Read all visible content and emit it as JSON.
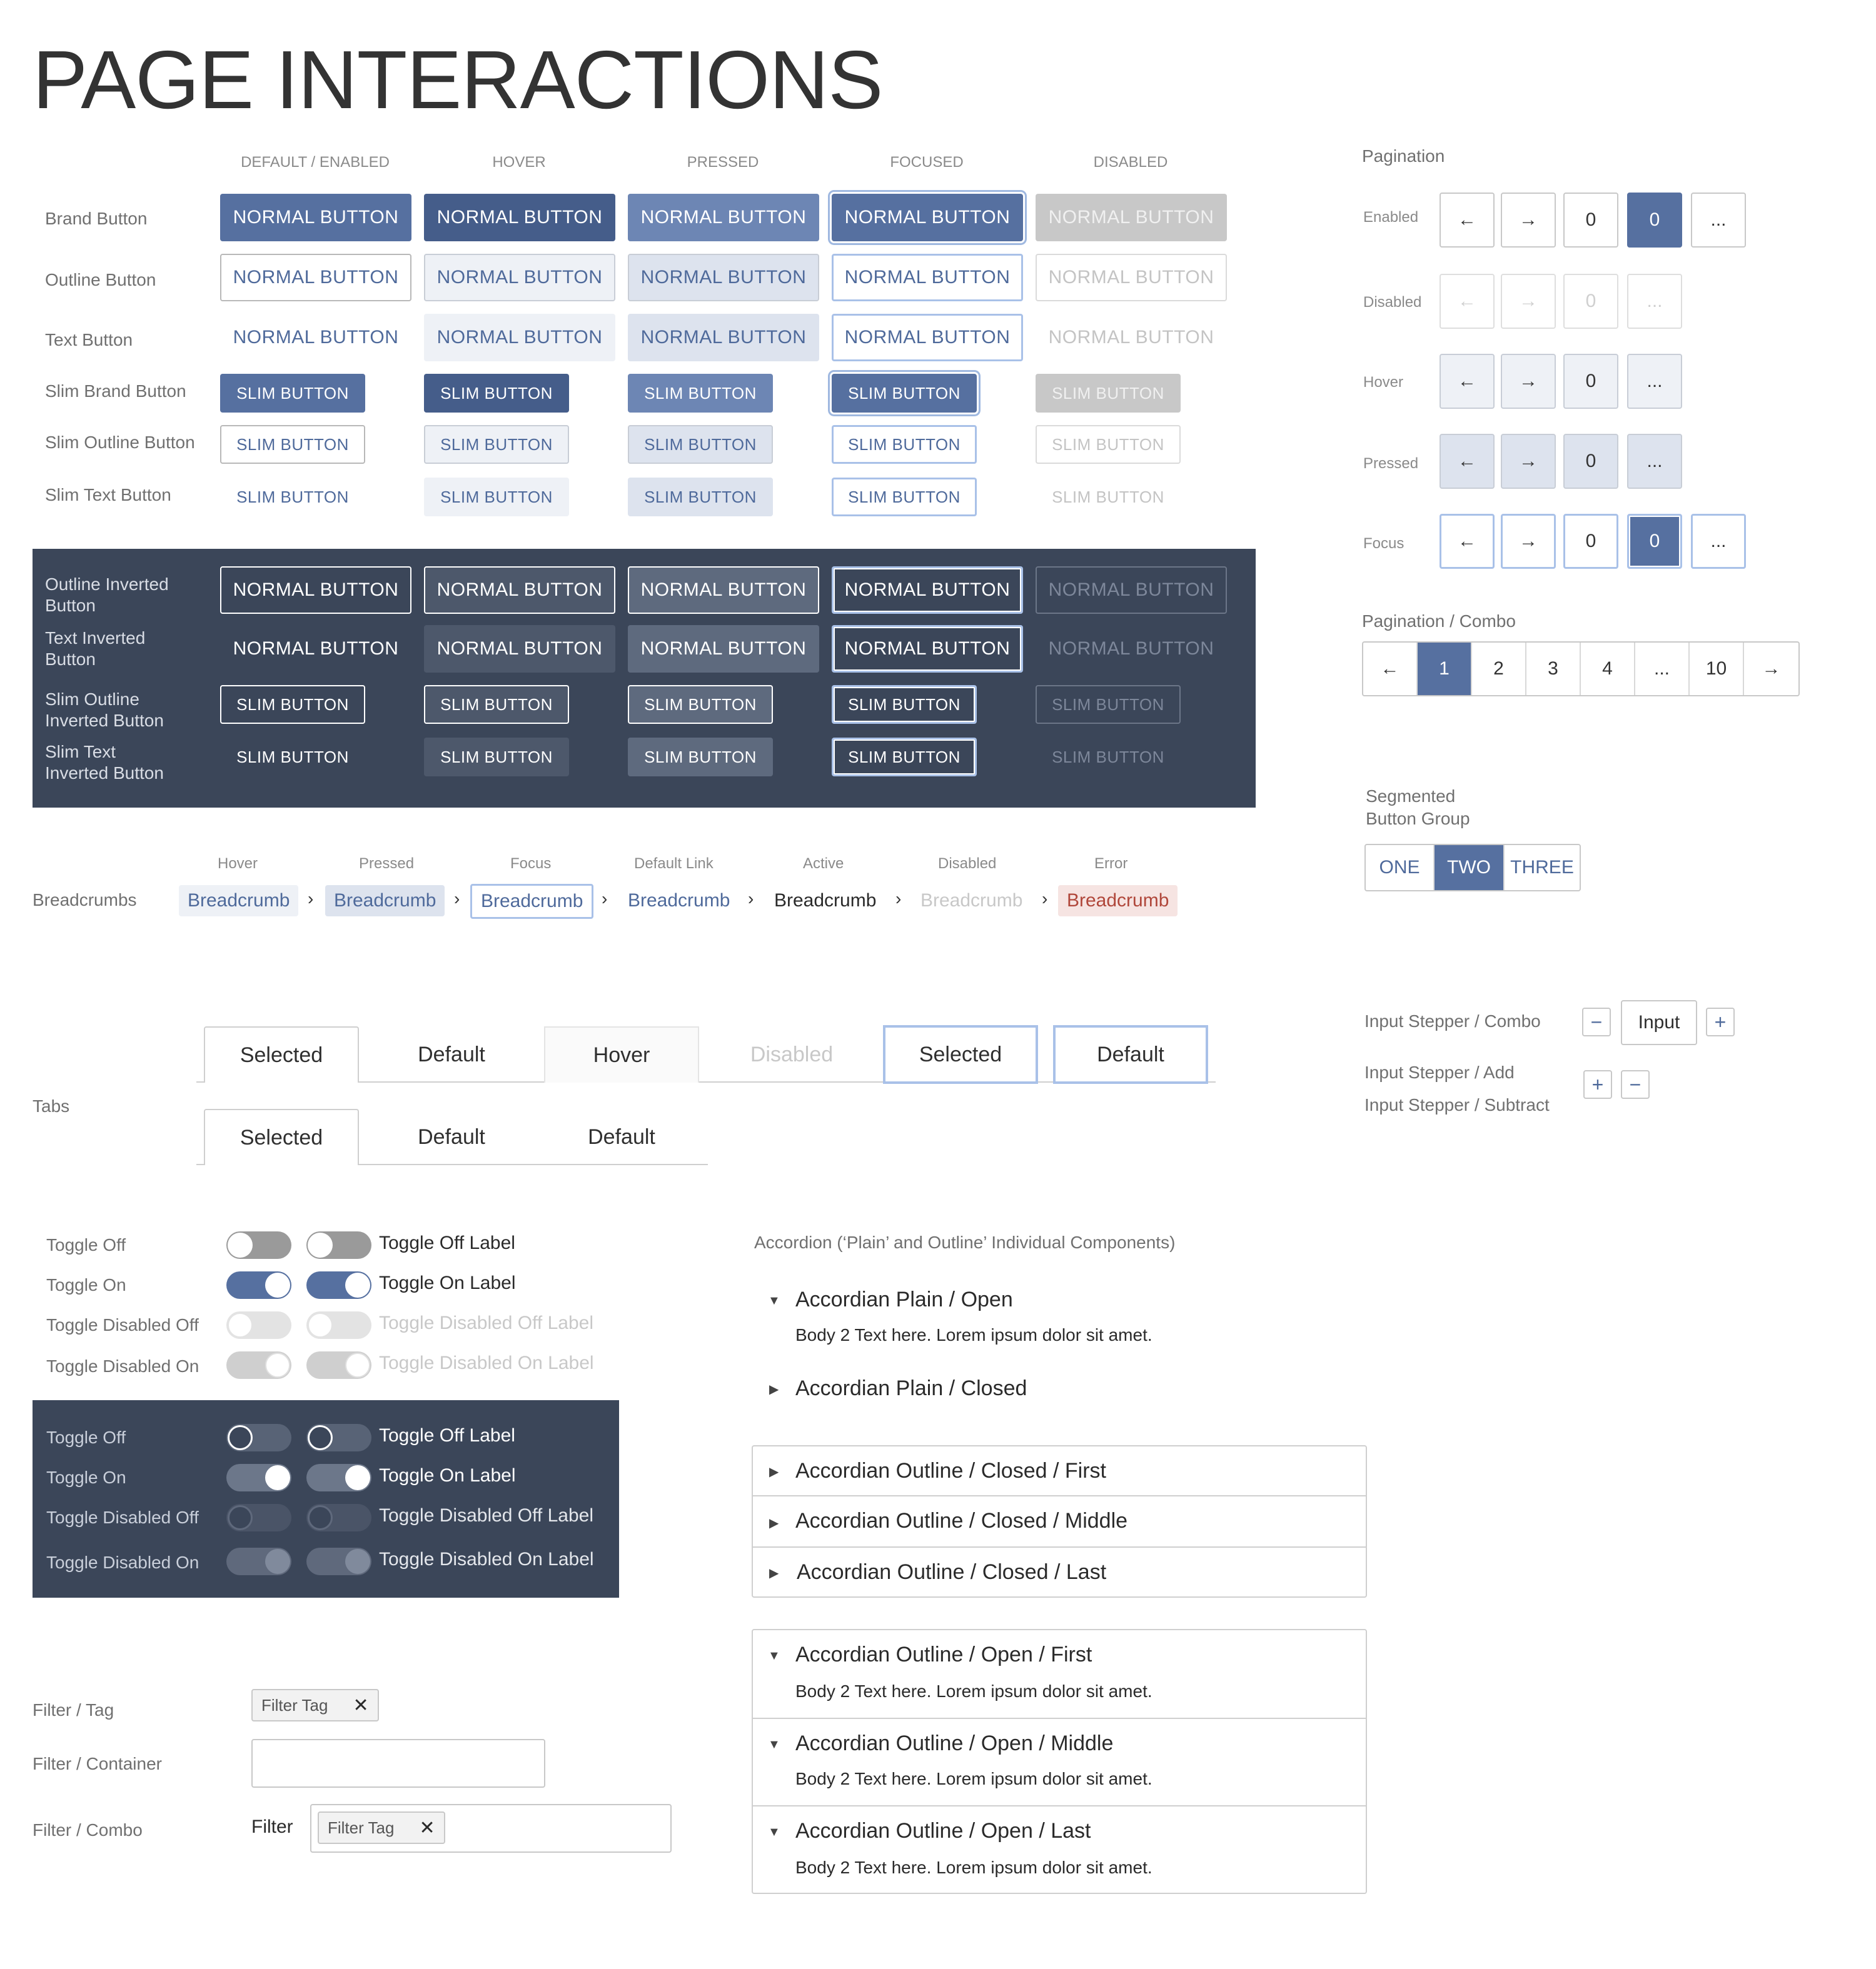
{
  "page_title": "PAGE INTERACTIONS",
  "columns": [
    "DEFAULT / ENABLED",
    "HOVER",
    "PRESSED",
    "FOCUSED",
    "DISABLED"
  ],
  "normal_label": "NORMAL BUTTON",
  "slim_label": "SLIM BUTTON",
  "button_rows": {
    "brand": "Brand Button",
    "outline": "Outline Button",
    "text": "Text Button",
    "slim_brand": "Slim Brand Button",
    "slim_outline": "Slim Outline Button",
    "slim_text": "Slim Text Button"
  },
  "inverted_rows": {
    "outline_1": "Outline Inverted",
    "outline_2": "Button",
    "text_1": "Text Inverted",
    "text_2": "Button",
    "slim_outline_1": "Slim Outline",
    "slim_outline_2": "Inverted Button",
    "slim_text_1": "Slim Text",
    "slim_text_2": "Inverted Button"
  },
  "pagination": {
    "title": "Pagination",
    "rows": [
      "Enabled",
      "Disabled",
      "Hover",
      "Pressed",
      "Focus"
    ],
    "prev": "←",
    "next": "→",
    "num": "0",
    "more": "..."
  },
  "pagination_combo": {
    "title": "Pagination / Combo",
    "prev": "←",
    "next": "→",
    "pages": [
      "1",
      "2",
      "3",
      "4",
      "...",
      "10"
    ],
    "active_index": 0
  },
  "segmented": {
    "title_1": "Segmented",
    "title_2": "Button Group",
    "options": [
      "ONE",
      "TWO",
      "THREE"
    ],
    "active_index": 1
  },
  "breadcrumbs": {
    "label": "Breadcrumbs",
    "states": [
      "Hover",
      "Pressed",
      "Focus",
      "Default Link",
      "Active",
      "Disabled",
      "Error"
    ],
    "item": "Breadcrumb",
    "separator": "›"
  },
  "tabs": {
    "label": "Tabs",
    "row1": [
      "Selected",
      "Default",
      "Hover",
      "Disabled",
      "Selected",
      "Default"
    ],
    "row2": [
      "Selected",
      "Default",
      "Default"
    ]
  },
  "stepper": {
    "combo_label": "Input Stepper / Combo",
    "add_label": "Input Stepper / Add",
    "subtract_label": "Input Stepper / Subtract",
    "minus": "−",
    "plus": "+",
    "input_value": "Input"
  },
  "toggles": {
    "rows": [
      "Toggle Off",
      "Toggle On",
      "Toggle Disabled Off",
      "Toggle Disabled On"
    ],
    "labels": [
      "Toggle Off Label",
      "Toggle On Label",
      "Toggle Disabled Off Label",
      "Toggle Disabled On Label"
    ]
  },
  "filters": {
    "tag_label": "Filter / Tag",
    "container_label": "Filter / Container",
    "combo_label": "Filter / Combo",
    "tag_text": "Filter Tag",
    "close": "✕",
    "combo_prefix": "Filter"
  },
  "accordion": {
    "section_title": "Accordion (‘Plain’ and Outline’ Individual Components)",
    "plain_open": "Accordian Plain / Open",
    "plain_closed": "Accordian Plain / Closed",
    "outline_closed": [
      "Accordian Outline / Closed / First",
      "Accordian Outline / Closed / Middle",
      "Accordian Outline / Closed / Last"
    ],
    "outline_open": [
      "Accordian Outline / Open / First",
      "Accordian Outline / Open / Middle",
      "Accordian Outline / Open / Last"
    ],
    "body": "Body 2 Text here. Lorem ipsum dolor sit amet.",
    "caret_open": "▼",
    "caret_closed": "▶"
  },
  "colors": {
    "brand": "#5670a0",
    "inverted_panel": "#3b4659",
    "focus_ring": "#a9c1e8",
    "error_bg": "#f6e4e2",
    "error_text": "#b0473b"
  }
}
